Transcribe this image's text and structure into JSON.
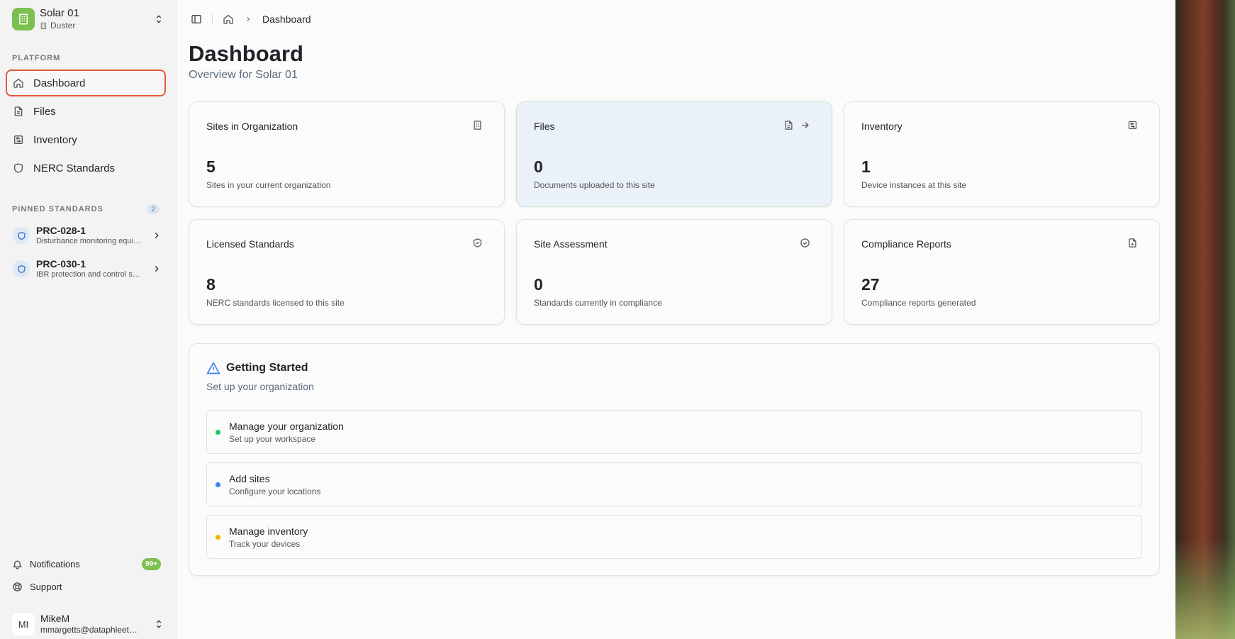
{
  "org": {
    "name": "Solar 01",
    "subtitle": "Duster"
  },
  "sidebar": {
    "platform_label": "PLATFORM",
    "nav": [
      {
        "label": "Dashboard",
        "icon": "home-icon",
        "active": true
      },
      {
        "label": "Files",
        "icon": "file-icon"
      },
      {
        "label": "Inventory",
        "icon": "inventory-icon"
      },
      {
        "label": "NERC Standards",
        "icon": "shield-icon"
      }
    ],
    "pinned_label": "PINNED STANDARDS",
    "pinned_count": "2",
    "pinned": [
      {
        "title": "PRC-028-1",
        "desc": "Disturbance monitoring equipment"
      },
      {
        "title": "PRC-030-1",
        "desc": "IBR protection and control settings"
      }
    ],
    "notifications_label": "Notifications",
    "notifications_badge": "99+",
    "support_label": "Support",
    "user": {
      "initials": "MI",
      "name": "MikeM",
      "email": "mmargetts@dataphleet.com"
    }
  },
  "breadcrumb": {
    "current": "Dashboard"
  },
  "page": {
    "title": "Dashboard",
    "subtitle": "Overview for Solar 01"
  },
  "cards": [
    {
      "title": "Sites in Organization",
      "value": "5",
      "desc": "Sites in your current organization",
      "icon": "building-icon"
    },
    {
      "title": "Files",
      "value": "0",
      "desc": "Documents uploaded to this site",
      "icon": "file-icon"
    },
    {
      "title": "Inventory",
      "value": "1",
      "desc": "Device instances at this site",
      "icon": "inventory-icon"
    },
    {
      "title": "Licensed Standards",
      "value": "8",
      "desc": "NERC standards licensed to this site",
      "icon": "shield-check-icon"
    },
    {
      "title": "Site Assessment",
      "value": "0",
      "desc": "Standards currently in compliance",
      "icon": "check-circle-icon"
    },
    {
      "title": "Compliance Reports",
      "value": "27",
      "desc": "Compliance reports generated",
      "icon": "report-icon"
    }
  ],
  "getting_started": {
    "title": "Getting Started",
    "subtitle": "Set up your organization",
    "items": [
      {
        "title": "Manage your organization",
        "desc": "Set up your workspace",
        "color": "#22c55e"
      },
      {
        "title": "Add sites",
        "desc": "Configure your locations",
        "color": "#3b82f6"
      },
      {
        "title": "Manage inventory",
        "desc": "Track your devices",
        "color": "#f5b300"
      }
    ]
  },
  "colors": {
    "brand": "#7cc04f",
    "active_outline": "#e05a3b",
    "files_card_bg": "#eaf1f8"
  }
}
